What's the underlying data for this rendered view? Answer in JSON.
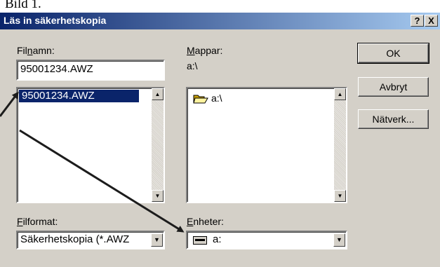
{
  "doc_caption": "Bild 1.",
  "window": {
    "title": "Läs in säkerhetskopia",
    "help_label": "?",
    "close_label": "X"
  },
  "filename": {
    "label_pre": "Fil",
    "label_accel": "n",
    "label_post": "amn:",
    "value": "95001234.AWZ",
    "list_items": [
      "95001234.AWZ"
    ]
  },
  "folders": {
    "label_accel": "M",
    "label_post": "appar:",
    "current_path": "a:\\",
    "tree_items": [
      "a:\\"
    ]
  },
  "file_format": {
    "label_accel": "F",
    "label_post": "ilformat:",
    "selected": "Säkerhetskopia (*.AWZ"
  },
  "drives": {
    "label_accel": "E",
    "label_post": "nheter:",
    "selected": "a:"
  },
  "buttons": {
    "ok": "OK",
    "cancel": "Avbryt",
    "network": "Nätverk..."
  },
  "icons": {
    "folder": "open-folder-icon",
    "drive": "floppy-drive-icon",
    "scroll_up": "scroll-up-arrow-icon",
    "scroll_down": "scroll-down-arrow-icon",
    "dropdown": "dropdown-arrow-icon",
    "annotation": "annotation-arrow"
  },
  "colors": {
    "title_start": "#0a246a",
    "title_end": "#a6caf0",
    "dialog_face": "#d4d0c8",
    "selection": "#0a246a",
    "arrow": "#1c1c1c"
  }
}
